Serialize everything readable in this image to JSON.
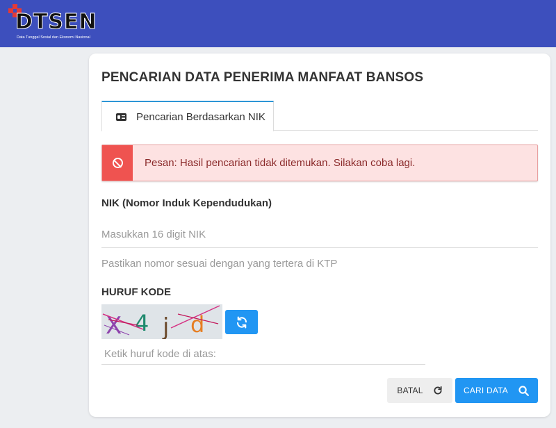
{
  "header": {
    "logo_text": "DTSEN",
    "logo_tagline": "Data Tunggal Sosial dan Ekonomi Nasional",
    "bg_color": "#3d4fbd"
  },
  "page": {
    "title": "PENCARIAN DATA PENERIMA MANFAAT BANSOS"
  },
  "tabs": [
    {
      "label": "Pencarian Berdasarkan NIK",
      "icon": "id-card-icon",
      "active": true
    }
  ],
  "alert": {
    "type": "error",
    "icon": "ban-icon",
    "message": "Pesan: Hasil pencarian tidak ditemukan. Silakan coba lagi.",
    "color": "#ef5350"
  },
  "nik": {
    "label": "NIK (Nomor Induk Kependudukan)",
    "value": "",
    "placeholder": "Masukkan 16 digit NIK",
    "help": "Pastikan nomor sesuai dengan yang tertera di KTP"
  },
  "captcha": {
    "label": "HURUF KODE",
    "characters": [
      "X",
      "4",
      "j",
      "d"
    ],
    "refresh_icon": "refresh-icon",
    "input_placeholder": "Ketik huruf kode di atas:",
    "input_value": ""
  },
  "actions": {
    "cancel_label": "BATAL",
    "cancel_icon": "refresh-icon",
    "search_label": "CARI DATA",
    "search_icon": "search-icon",
    "accent": "#2196f3"
  }
}
